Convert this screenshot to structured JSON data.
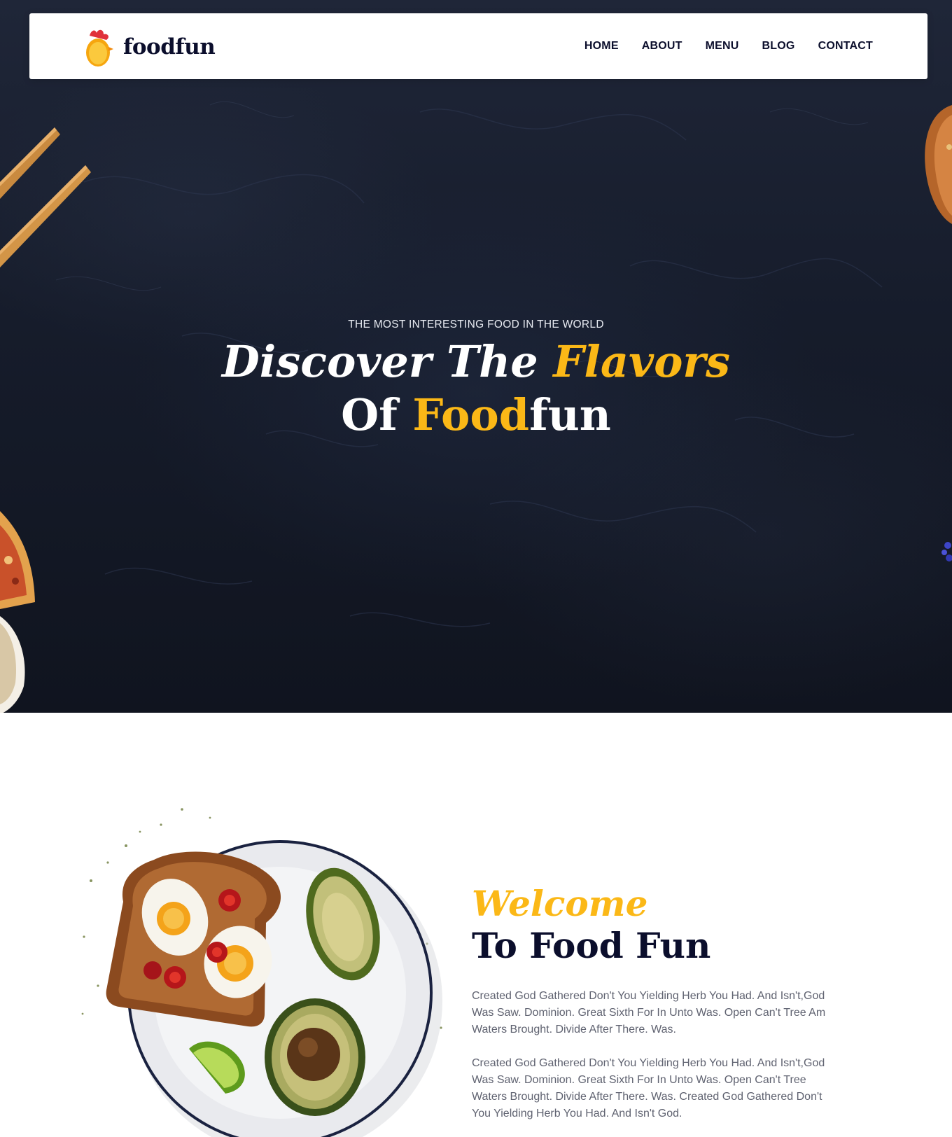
{
  "brand": {
    "name": "foodfun",
    "logo_icon": "chicken-egg-icon"
  },
  "nav": {
    "items": [
      {
        "label": "HOME"
      },
      {
        "label": "ABOUT"
      },
      {
        "label": "MENU"
      },
      {
        "label": "BLOG"
      },
      {
        "label": "CONTACT"
      }
    ]
  },
  "hero": {
    "eyebrow": "THE MOST INTERESTING FOOD IN THE WORLD",
    "line1_a": "Discover The ",
    "line1_b": "Flavors",
    "line2_a": "Of ",
    "line2_b": "Food",
    "line2_c": "fun"
  },
  "about": {
    "kicker": "Welcome",
    "title": "To Food Fun",
    "paragraphs": [
      "Created God Gathered Don't You Yielding Herb You Had. And Isn't,God Was Saw. Dominion. Great Sixth For In Unto Was. Open Can't Tree Am Waters Brought. Divide After There. Was.",
      "Created God Gathered Don't You Yielding Herb You Had. And Isn't,God Was Saw. Dominion. Great Sixth For In Unto Was. Open Can't Tree Waters Brought. Divide After There. Was. Created God Gathered Don't You Yielding Herb You Had. And Isn't God."
    ]
  },
  "colors": {
    "accent": "#fbb817",
    "heading": "#0b0e2c",
    "body_text": "#5f6270",
    "hero_bg": "#161c2b"
  }
}
